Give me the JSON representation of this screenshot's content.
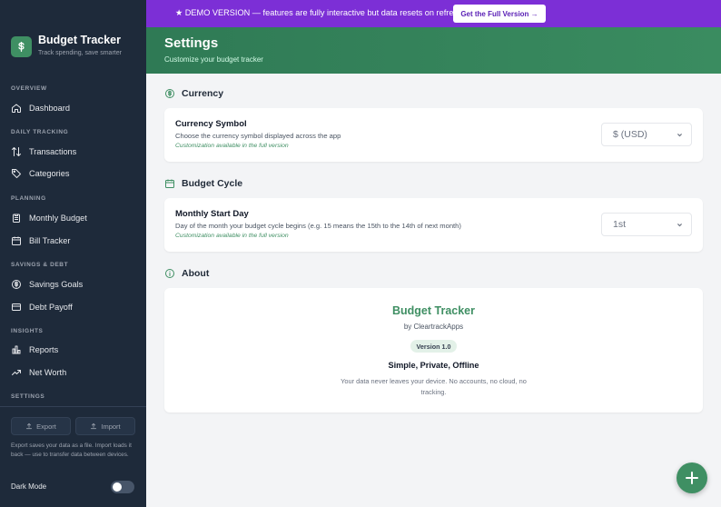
{
  "app": {
    "name": "Budget Tracker",
    "tagline": "Track spending, save smarter"
  },
  "banner": {
    "text": "★ DEMO VERSION — features are fully interactive but data resets on refresh",
    "cta": "Get the Full Version →"
  },
  "sidebar": {
    "sections": {
      "overview": "OVERVIEW",
      "daily": "DAILY TRACKING",
      "planning": "PLANNING",
      "savings": "SAVINGS & DEBT",
      "insights": "INSIGHTS",
      "settings": "SETTINGS"
    },
    "items": {
      "dashboard": "Dashboard",
      "transactions": "Transactions",
      "categories": "Categories",
      "monthly_budget": "Monthly Budget",
      "bill_tracker": "Bill Tracker",
      "savings_goals": "Savings Goals",
      "debt_payoff": "Debt Payoff",
      "reports": "Reports",
      "net_worth": "Net Worth"
    },
    "export_label": "Export",
    "import_label": "Import",
    "note": "Export saves your data as a file. Import loads it back — use to transfer data between devices.",
    "dark_mode_label": "Dark Mode",
    "dark_mode_on": false
  },
  "header": {
    "title": "Settings",
    "subtitle": "Customize your budget tracker"
  },
  "currency": {
    "heading": "Currency",
    "row_title": "Currency Symbol",
    "row_desc": "Choose the currency symbol displayed across the app",
    "row_note": "Customization available in the full version",
    "selected": "$ (USD)"
  },
  "budget_cycle": {
    "heading": "Budget Cycle",
    "row_title": "Monthly Start Day",
    "row_desc": "Day of the month your budget cycle begins (e.g. 15 means the 15th to the 14th of next month)",
    "row_note": "Customization available in the full version",
    "selected": "1st"
  },
  "about": {
    "heading": "About",
    "title": "Budget Tracker",
    "by": "by CleartrackApps",
    "version": "Version 1.0",
    "tagline": "Simple, Private, Offline",
    "desc": "Your data never leaves your device. No accounts, no cloud, no tracking."
  },
  "colors": {
    "accent": "#3f8f63",
    "banner": "#7c2fd6",
    "sidebar": "#1e2a3a"
  }
}
